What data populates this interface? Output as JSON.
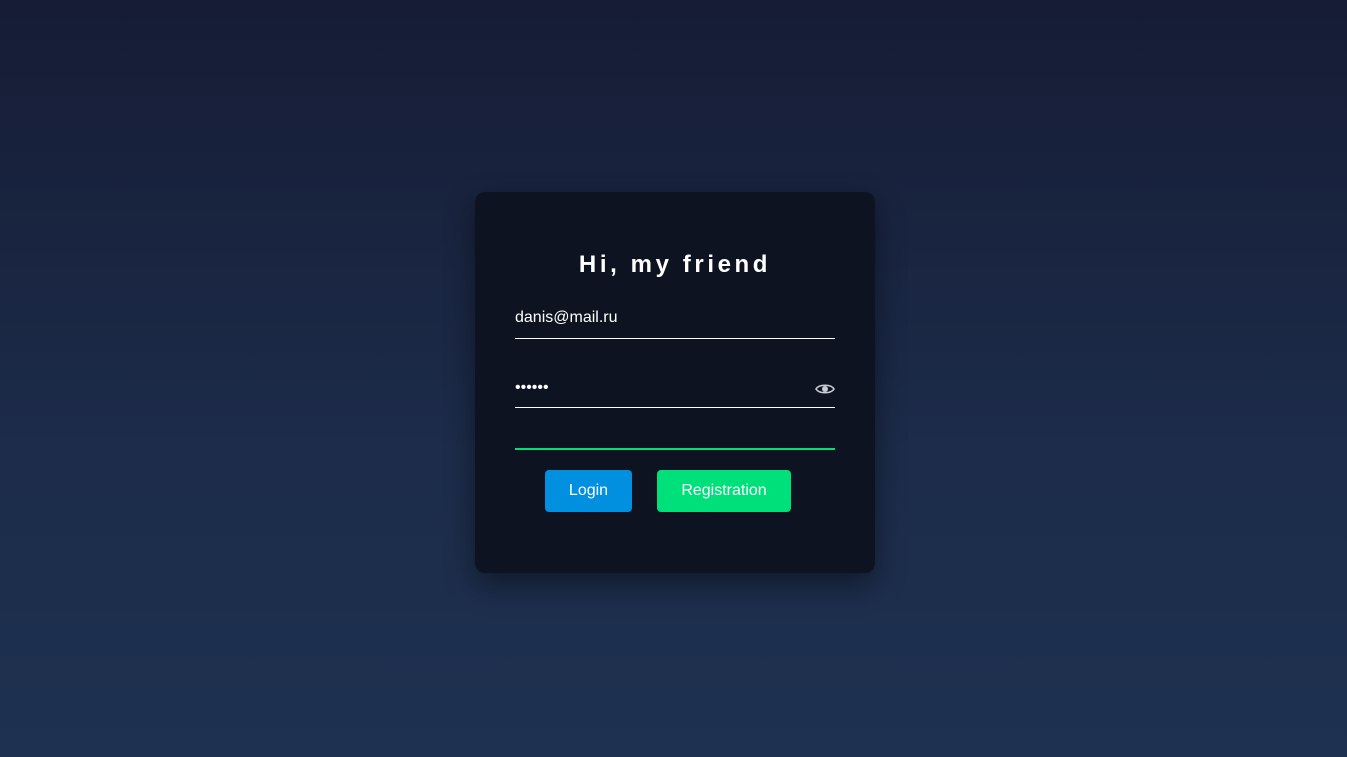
{
  "card": {
    "title": "Hi, my friend"
  },
  "form": {
    "email_value": "danis@mail.ru",
    "password_value": "••••••",
    "extra_value": ""
  },
  "buttons": {
    "login_label": "Login",
    "registration_label": "Registration"
  },
  "icons": {
    "password_toggle": "eye-icon"
  },
  "colors": {
    "login_button": "#0190df",
    "registration_button": "#00e07a",
    "active_underline": "#00e07a",
    "card_background": "#0d1320"
  }
}
